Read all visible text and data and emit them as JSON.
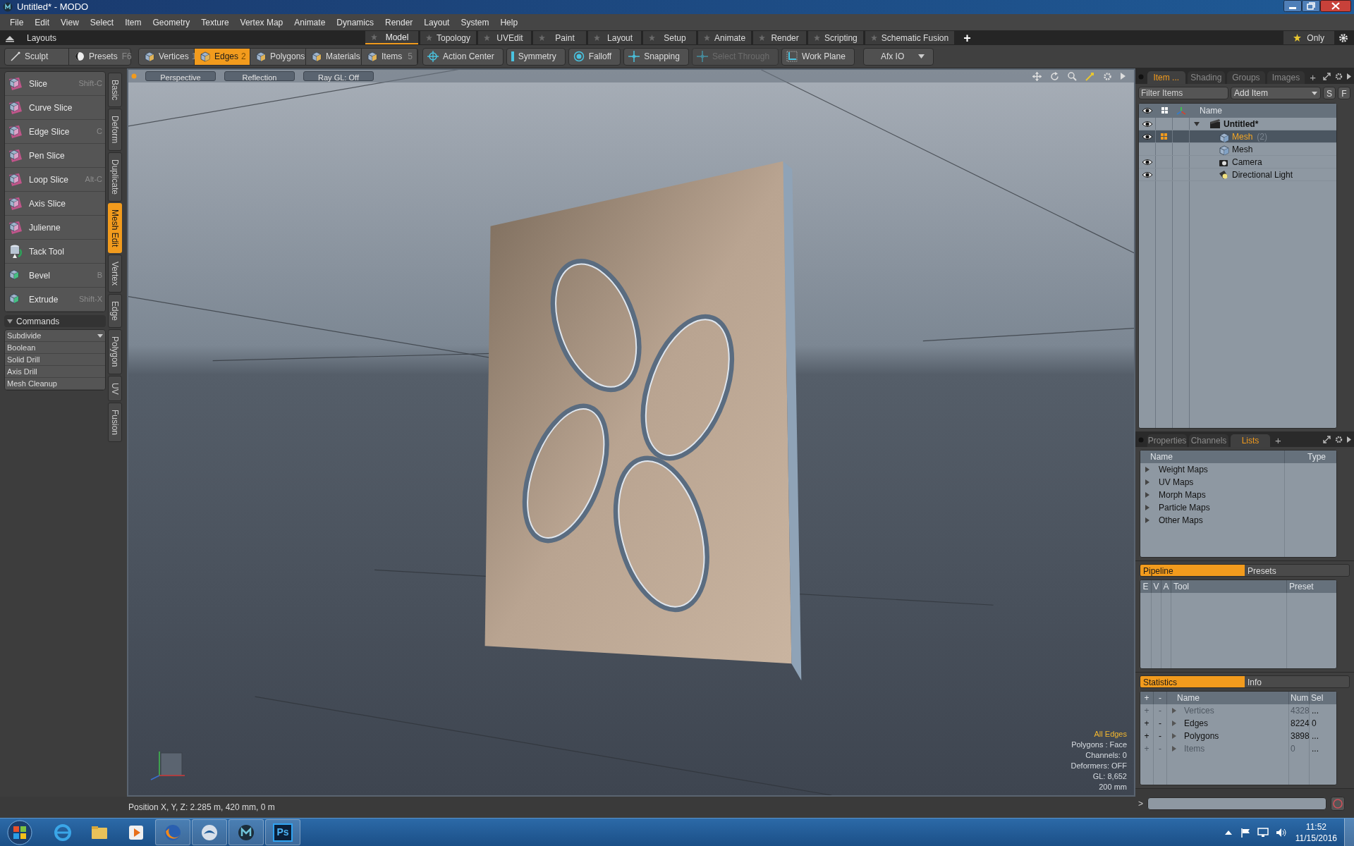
{
  "window": {
    "title": "Untitled* - MODO"
  },
  "menu": [
    "File",
    "Edit",
    "View",
    "Select",
    "Item",
    "Geometry",
    "Texture",
    "Vertex Map",
    "Animate",
    "Dynamics",
    "Render",
    "Layout",
    "System",
    "Help"
  ],
  "layouts": {
    "label": "Layouts",
    "add": "+",
    "only": "Only",
    "tabs": [
      {
        "label": "Model",
        "selected": true
      },
      {
        "label": "Topology",
        "selected": false
      },
      {
        "label": "UVEdit",
        "selected": false
      },
      {
        "label": "Paint",
        "selected": false
      },
      {
        "label": "Layout",
        "selected": false
      },
      {
        "label": "Setup",
        "selected": false
      },
      {
        "label": "Animate",
        "selected": false
      },
      {
        "label": "Render",
        "selected": false
      },
      {
        "label": "Scripting",
        "selected": false
      },
      {
        "label": "Schematic Fusion",
        "selected": false
      }
    ]
  },
  "toolbar": {
    "sculpt": "Sculpt",
    "presets": {
      "label": "Presets",
      "shortcut": "F6"
    },
    "modes": [
      {
        "label": "Vertices",
        "shortcut": "1",
        "selected": false
      },
      {
        "label": "Edges",
        "shortcut": "2",
        "selected": true
      },
      {
        "label": "Polygons",
        "selected": false
      },
      {
        "label": "Materials",
        "selected": false
      },
      {
        "label": "Items",
        "shortcut": "5",
        "selected": false
      }
    ],
    "options": [
      {
        "label": "Action Center",
        "kind": "target",
        "disabled": false
      },
      {
        "label": "Symmetry",
        "kind": "bar",
        "disabled": false
      },
      {
        "label": "Falloff",
        "kind": "ring",
        "disabled": false
      },
      {
        "label": "Snapping",
        "kind": "cross",
        "disabled": false
      },
      {
        "label": "Select Through",
        "kind": "cross",
        "disabled": true
      },
      {
        "label": "Work Plane",
        "kind": "plane",
        "disabled": false
      }
    ],
    "dropdown": "Afx IO"
  },
  "tools": [
    {
      "label": "Slice",
      "shortcut": "Shift-C",
      "kind": "slice"
    },
    {
      "label": "Curve Slice",
      "kind": "slice"
    },
    {
      "label": "Edge Slice",
      "shortcut": "C",
      "kind": "slice"
    },
    {
      "label": "Pen Slice",
      "kind": "slice"
    },
    {
      "label": "Loop Slice",
      "shortcut": "Alt-C",
      "kind": "slice"
    },
    {
      "label": "Axis Slice",
      "kind": "slice"
    },
    {
      "label": "Julienne",
      "kind": "slice"
    },
    {
      "label": "Tack Tool",
      "kind": "tack"
    },
    {
      "label": "Bevel",
      "shortcut": "B",
      "kind": "bevel"
    },
    {
      "label": "Extrude",
      "shortcut": "Shift-X",
      "kind": "bevel"
    }
  ],
  "commands": {
    "title": "Commands",
    "expanded": true,
    "dropdown": "Subdivide",
    "items": [
      "Boolean",
      "Solid Drill",
      "Axis Drill",
      "Mesh Cleanup"
    ]
  },
  "side_tabs": [
    {
      "label": "Basic",
      "selected": false
    },
    {
      "label": "Deform",
      "selected": false
    },
    {
      "label": "Duplicate",
      "selected": false
    },
    {
      "label": "Mesh Edit",
      "selected": true
    },
    {
      "label": "Vertex",
      "selected": false
    },
    {
      "label": "Edge",
      "selected": false
    },
    {
      "label": "Polygon",
      "selected": false
    },
    {
      "label": "UV",
      "selected": false
    },
    {
      "label": "Fusion",
      "selected": false
    }
  ],
  "viewport": {
    "buttons": [
      "Perspective",
      "Reflection",
      "Ray GL: Off"
    ],
    "overlay_title": "All Edges",
    "overlay": [
      "Polygons : Face",
      "Channels: 0",
      "Deformers: OFF",
      "GL: 8,652",
      "200 mm"
    ],
    "status": "Position X, Y, Z:  2.285 m, 420 mm, 0 m"
  },
  "items_panel": {
    "add": "+",
    "tabs": [
      {
        "label": "Item  ...",
        "selected": true
      },
      {
        "label": "Shading",
        "selected": false
      },
      {
        "label": "Groups",
        "selected": false
      },
      {
        "label": "Images",
        "selected": false
      }
    ],
    "filter": {
      "placeholder": "Filter Items"
    },
    "add_item": "Add Item",
    "buttons": [
      "S",
      "F"
    ],
    "column": "Name",
    "tree": [
      {
        "label": "Untitled*",
        "kind": "scene",
        "visible": true,
        "selected": false,
        "expanded": true,
        "children": [
          {
            "label": "Mesh",
            "note": "(2)",
            "kind": "mesh",
            "visible": true,
            "selected": true
          },
          {
            "label": "Mesh",
            "kind": "mesh",
            "visible": false,
            "selected": false
          },
          {
            "label": "Camera",
            "kind": "camera",
            "visible": true,
            "selected": false
          },
          {
            "label": "Directional Light",
            "kind": "light",
            "visible": true,
            "selected": false
          }
        ]
      }
    ]
  },
  "lists_panel": {
    "add": "+",
    "tabs": [
      {
        "label": "Properties",
        "selected": false
      },
      {
        "label": "Channels",
        "selected": false
      },
      {
        "label": "Lists",
        "selected": true
      }
    ],
    "columns": [
      "Name",
      "Type"
    ],
    "rows": [
      {
        "label": "Weight Maps",
        "expanded": false
      },
      {
        "label": "UV Maps",
        "expanded": false
      },
      {
        "label": "Morph Maps",
        "expanded": false
      },
      {
        "label": "Particle Maps",
        "expanded": false
      },
      {
        "label": "Other Maps",
        "expanded": false
      }
    ]
  },
  "pipeline": {
    "tabs": [
      {
        "label": "Pipeline",
        "selected": true
      },
      {
        "label": "Presets",
        "selected": false
      }
    ],
    "columns": [
      "E",
      "V",
      "A",
      "Tool",
      "Preset"
    ]
  },
  "statistics": {
    "tabs": [
      {
        "label": "Statistics",
        "selected": true
      },
      {
        "label": "Info",
        "selected": false
      }
    ],
    "columns": [
      "+",
      "-",
      "Name",
      "Num",
      "Sel"
    ],
    "rows": [
      {
        "plus": "+",
        "minus": "-",
        "name": "Vertices",
        "num": "4328",
        "sel": "...",
        "disabled": true
      },
      {
        "plus": "+",
        "minus": "-",
        "name": "Edges",
        "num": "8224",
        "sel": "0",
        "disabled": false
      },
      {
        "plus": "+",
        "minus": "-",
        "name": "Polygons",
        "num": "3898",
        "sel": "...",
        "disabled": false
      },
      {
        "plus": "+",
        "minus": "-",
        "name": "Items",
        "num": "0",
        "sel": "...",
        "disabled": true
      }
    ]
  },
  "command_line": {
    "prompt": ">"
  },
  "taskbar": {
    "apps": [
      {
        "kind": "ie",
        "running": false
      },
      {
        "kind": "folder",
        "running": false
      },
      {
        "kind": "media",
        "running": false
      },
      {
        "kind": "firefox",
        "running": true
      },
      {
        "kind": "mail",
        "running": true
      },
      {
        "kind": "modo",
        "running": true
      },
      {
        "kind": "photoshop",
        "label": "Ps",
        "running": true
      }
    ],
    "clock": {
      "time": "11:52",
      "date": "11/15/2016"
    }
  }
}
